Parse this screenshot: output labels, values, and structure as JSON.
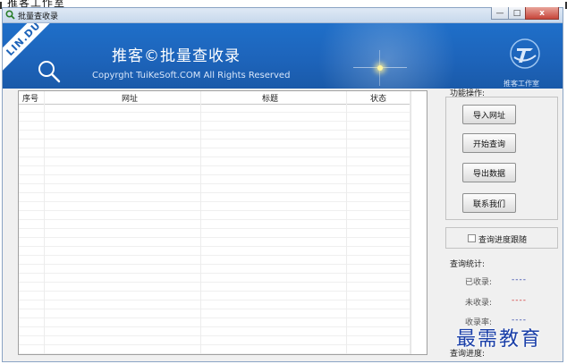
{
  "top_crop_text": "推客工作室",
  "window": {
    "title": "批量查收录",
    "buttons": {
      "minimize": "—",
      "maximize": "□",
      "close": "x"
    }
  },
  "banner": {
    "ribbon": "LIN.DU",
    "title": "推客©批量查收录",
    "copyright": "Copyrght TuiKeSoft.COM All Rights Reserved",
    "studio_name": "推客工作室",
    "icons": [
      "search-icon",
      "studio-logo-icon"
    ]
  },
  "table": {
    "columns": [
      "序号",
      "网址",
      "标题",
      "状态"
    ],
    "rows": []
  },
  "panel": {
    "operations_label": "功能操作:",
    "buttons": {
      "import": "导入网址",
      "start": "开始查询",
      "export": "导出数据",
      "contact": "联系我们"
    },
    "track_checkbox_label": "查询进度跟随",
    "track_checkbox_checked": false,
    "stats_label": "查询统计:",
    "stats": {
      "indexed_label": "已收录:",
      "indexed_value": "----",
      "indexed_color": "#2b3fa8",
      "not_indexed_label": "未收录:",
      "not_indexed_value": "----",
      "not_indexed_color": "#d03030",
      "rate_label": "收录率:",
      "rate_value": "----"
    },
    "progress_label": "查询进度:"
  },
  "watermark": "最需教育"
}
